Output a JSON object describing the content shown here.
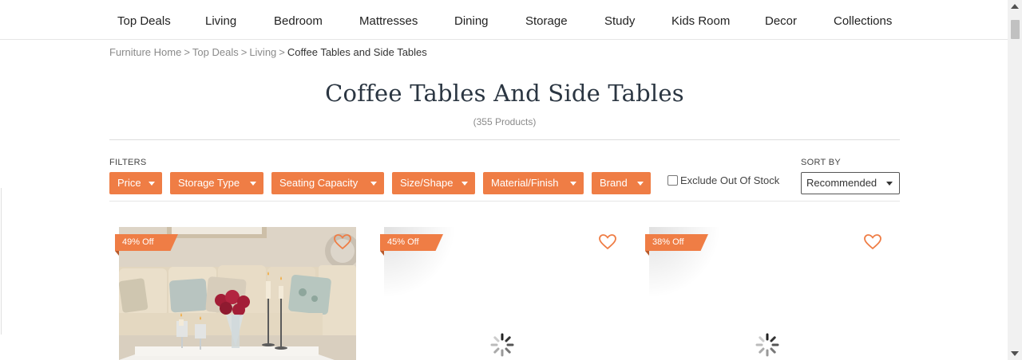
{
  "nav": [
    "Top Deals",
    "Living",
    "Bedroom",
    "Mattresses",
    "Dining",
    "Storage",
    "Study",
    "Kids Room",
    "Decor",
    "Collections"
  ],
  "breadcrumb": {
    "items": [
      "Furniture Home",
      "Top Deals",
      "Living"
    ],
    "separator": ">",
    "current": "Coffee Tables and Side Tables"
  },
  "page": {
    "title": "Coffee Tables And Side Tables",
    "count": "(355 Products)"
  },
  "filters": {
    "label": "FILTERS",
    "buttons": [
      "Price",
      "Storage Type",
      "Seating Capacity",
      "Size/Shape",
      "Material/Finish",
      "Brand"
    ],
    "exclude_label": "Exclude Out Of Stock"
  },
  "sort": {
    "label": "SORT BY",
    "selected": "Recommended"
  },
  "products": [
    {
      "discount": "49% Off",
      "image": "living-room-sofa-photo"
    },
    {
      "discount": "45% Off",
      "image": "loading-spinner"
    },
    {
      "discount": "38% Off",
      "image": "loading-spinner"
    }
  ],
  "colors": {
    "accent": "#ef7d45",
    "title": "#2b3642"
  }
}
